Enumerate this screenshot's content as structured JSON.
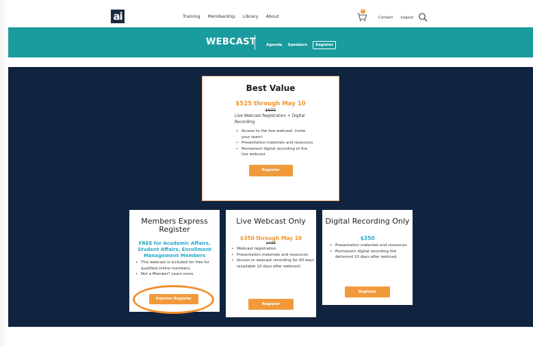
{
  "nav": {
    "logo": "ai",
    "links": [
      "Training",
      "Membership",
      "Library",
      "About"
    ],
    "cart_count": "0",
    "contact": "Contact",
    "logout": "Logout"
  },
  "subnav": {
    "title": "WEBCAST",
    "agenda": "Agenda",
    "speakers": "Speakers",
    "register": "Register"
  },
  "best_value": {
    "title": "Best Value",
    "price": "$525 through May 10",
    "old_price": "$600",
    "description": "Live Webcast Registration + Digital Recording",
    "bullets": [
      "Access to the live webcast: invite your team!",
      "Presentation materials and resources",
      "Permanent digital recording of the live webcast"
    ],
    "button": "Register"
  },
  "members": {
    "title": "Members Express Register",
    "offer": "FREE for Academic Affairs, Student Affairs, Enrollment Management Members",
    "bullets": [
      "This webcast is included for free for qualified online members.",
      "Not a Member? Learn more"
    ],
    "button": "Express Register"
  },
  "live": {
    "title": "Live Webcast Only",
    "price": "$350 through May 10",
    "old_price": "$425",
    "bullets": [
      "Webcast registration",
      "Presentation materials and resources",
      "Access to webcast recording for 60 days (available 10 days after webcast)"
    ],
    "button": "Register"
  },
  "digital": {
    "title": "Digital Recording Only",
    "price": "$350",
    "bullets": [
      "Presentation materials and resources",
      "Permanent digital recording link delivered 10 days after webcast"
    ],
    "button": "Register"
  },
  "colors": {
    "teal_bar": "#1a9b9e",
    "dark_section": "#102440",
    "accent_orange": "#f0932b",
    "accent_teal": "#27a7c7"
  }
}
